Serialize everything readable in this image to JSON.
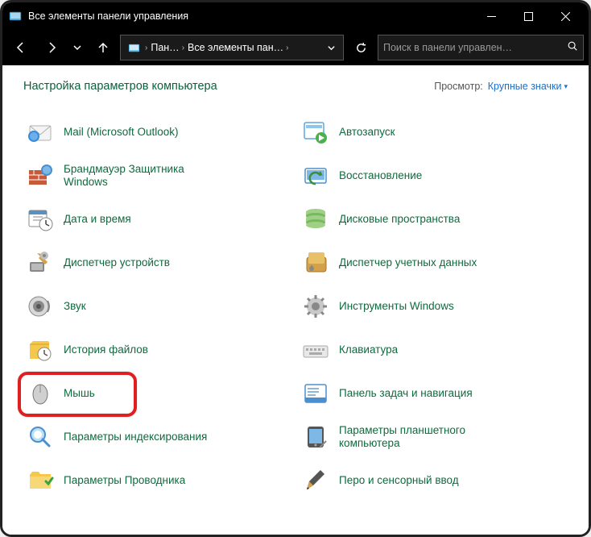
{
  "titlebar": {
    "title": "Все элементы панели управления"
  },
  "toolbar": {
    "breadcrumb1": "Пан…",
    "breadcrumb2": "Все элементы пан…",
    "searchPlaceholder": "Поиск в панели управлен…"
  },
  "header": {
    "heading": "Настройка параметров компьютера",
    "viewLabel": "Просмотр:",
    "viewValue": "Крупные значки"
  },
  "items": [
    {
      "label": "Mail (Microsoft Outlook)",
      "icon": "mail-icon"
    },
    {
      "label": "Автозапуск",
      "icon": "autoplay-icon"
    },
    {
      "label": "Брандмауэр Защитника Windows",
      "icon": "firewall-icon",
      "wrap": true
    },
    {
      "label": "Восстановление",
      "icon": "recovery-icon"
    },
    {
      "label": "Дата и время",
      "icon": "datetime-icon"
    },
    {
      "label": "Дисковые пространства",
      "icon": "storage-icon"
    },
    {
      "label": "Диспетчер устройств",
      "icon": "devicemanager-icon"
    },
    {
      "label": "Диспетчер учетных данных",
      "icon": "credentials-icon",
      "wrap": true
    },
    {
      "label": "Звук",
      "icon": "sound-icon"
    },
    {
      "label": "Инструменты Windows",
      "icon": "tools-icon"
    },
    {
      "label": "История файлов",
      "icon": "history-icon"
    },
    {
      "label": "Клавиатура",
      "icon": "keyboard-icon"
    },
    {
      "label": "Мышь",
      "icon": "mouse-icon",
      "highlighted": true
    },
    {
      "label": "Панель задач и навигация",
      "icon": "taskbar-icon",
      "wrap": true
    },
    {
      "label": "Параметры индексирования",
      "icon": "indexing-icon",
      "wrap": true
    },
    {
      "label": "Параметры планшетного компьютера",
      "icon": "tablet-icon",
      "wrap": true
    },
    {
      "label": "Параметры Проводника",
      "icon": "explorer-icon"
    },
    {
      "label": "Перо и сенсорный ввод",
      "icon": "pen-icon"
    }
  ]
}
